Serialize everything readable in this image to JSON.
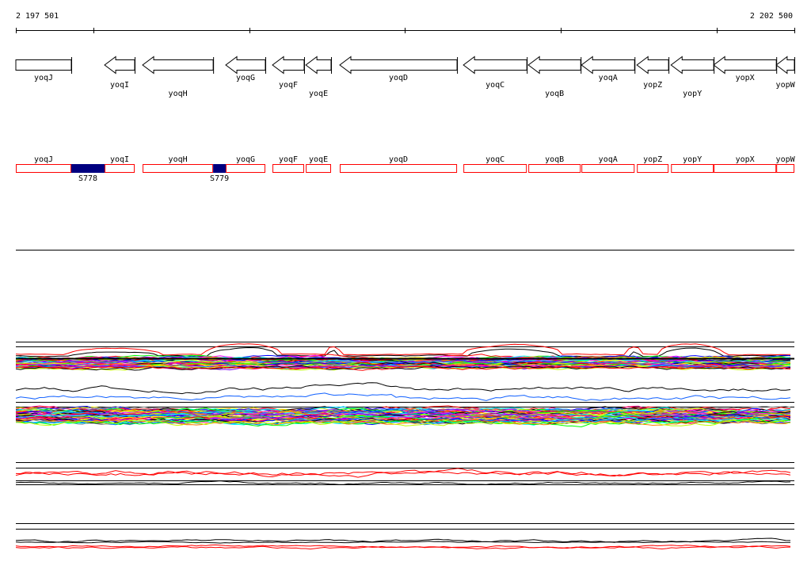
{
  "ruler": {
    "start_label": "2 197 501",
    "end_label": "2 202 500",
    "start": 2197501,
    "end": 2202500
  },
  "genes": [
    {
      "name": "yoqJ",
      "start": 2197501,
      "end": 2197857,
      "strand": "+"
    },
    {
      "name": "yoqI",
      "start": 2198071,
      "end": 2198264,
      "strand": "-"
    },
    {
      "name": "yoqH",
      "start": 2198315,
      "end": 2198768,
      "strand": "-"
    },
    {
      "name": "yoqG",
      "start": 2198849,
      "end": 2199103,
      "strand": "-"
    },
    {
      "name": "yoqF",
      "start": 2199149,
      "end": 2199352,
      "strand": "-"
    },
    {
      "name": "yoqE",
      "start": 2199363,
      "end": 2199525,
      "strand": "-"
    },
    {
      "name": "yoqD",
      "start": 2199581,
      "end": 2200334,
      "strand": "-"
    },
    {
      "name": "yoqC",
      "start": 2200375,
      "end": 2200782,
      "strand": "-"
    },
    {
      "name": "yoqB",
      "start": 2200792,
      "end": 2201128,
      "strand": "-"
    },
    {
      "name": "yoqA",
      "start": 2201133,
      "end": 2201474,
      "strand": "-"
    },
    {
      "name": "yopZ",
      "start": 2201489,
      "end": 2201692,
      "strand": "-"
    },
    {
      "name": "yopY",
      "start": 2201708,
      "end": 2201982,
      "strand": "-"
    },
    {
      "name": "yopX",
      "start": 2201982,
      "end": 2202384,
      "strand": "-"
    },
    {
      "name": "yopW",
      "start": 2202384,
      "end": 2202500,
      "strand": "-"
    }
  ],
  "segments": [
    {
      "name": "S778",
      "start": 2197857,
      "end": 2198071
    },
    {
      "name": "S779",
      "start": 2198768,
      "end": 2198849
    }
  ],
  "colors": {
    "segment_fill": "#000080",
    "gene_box_border": "#ff0000",
    "axis": "#000000"
  }
}
